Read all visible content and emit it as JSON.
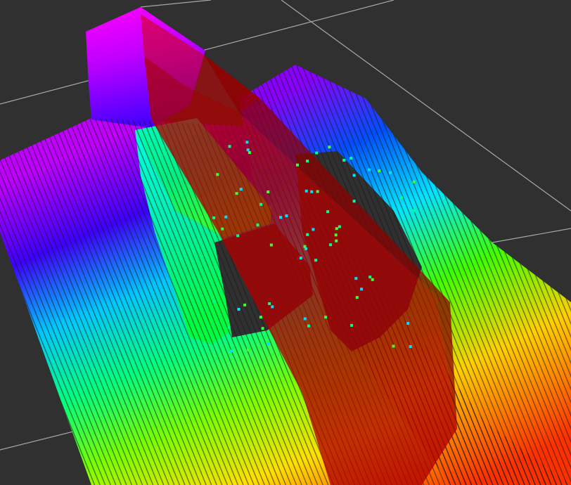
{
  "viewport": {
    "background_color": "#303030",
    "grid_color": "#a8a8a8",
    "marker_color": "#b00000",
    "marker_opacity": 0.82
  },
  "pointcloud": {
    "color_scheme": "rainbow-height",
    "stops": [
      "#ff2000",
      "#ff8c00",
      "#ffe600",
      "#b8ff00",
      "#3cff00",
      "#00ff9a",
      "#00e0ff",
      "#0058ff",
      "#6a00ff",
      "#d200ff"
    ]
  }
}
